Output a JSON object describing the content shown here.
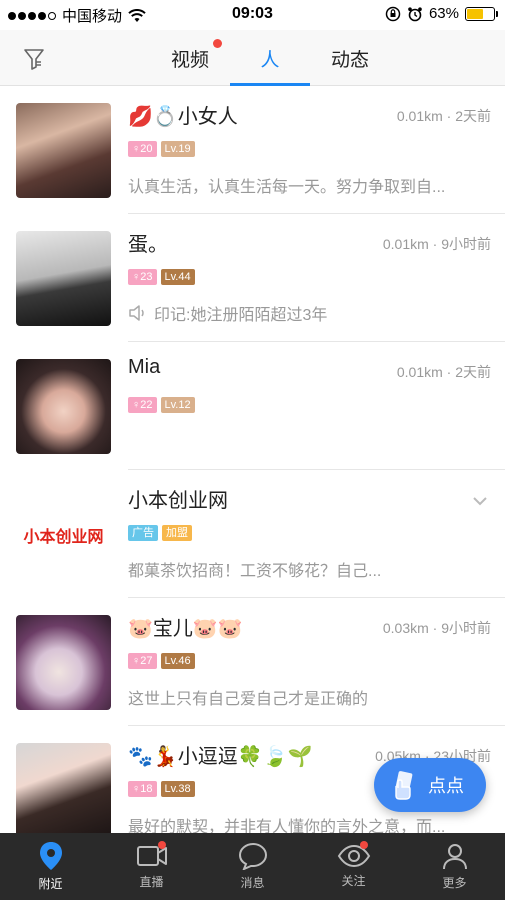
{
  "status_bar": {
    "carrier": "中国移动",
    "time": "09:03",
    "battery_percent": "63%",
    "battery_level": 0.63
  },
  "header": {
    "filter_icon": "filter-icon",
    "tabs": [
      {
        "label": "视频",
        "active": false,
        "has_dot": true
      },
      {
        "label": "人",
        "active": true,
        "has_dot": false
      },
      {
        "label": "动态",
        "active": false,
        "has_dot": false
      }
    ]
  },
  "people": [
    {
      "name": "💋💍小女人",
      "meta": "0.01km · 2天前",
      "age": "♀20",
      "level": "Lv.19",
      "bio": "认真生活，认真生活每一天。努力争取到自..."
    },
    {
      "name": "蛋。",
      "meta": "0.01km · 9小时前",
      "age": "♀23",
      "level": "Lv.44",
      "bio": "印记:她注册陌陌超过3年"
    },
    {
      "name": "Mia",
      "meta": "0.01km · 2天前",
      "age": "♀22",
      "level": "Lv.12",
      "bio": ""
    },
    {
      "name": "小本创业网",
      "logo_text": "小本创业网",
      "meta": "",
      "tag1": "广告",
      "tag2": "加盟",
      "bio": "都菓茶饮招商！工资不够花？自己..."
    },
    {
      "name": "🐷宝儿🐷🐷",
      "meta": "0.03km · 9小时前",
      "age": "♀27",
      "level": "Lv.46",
      "bio": "这世上只有自己爱自己才是正确的"
    },
    {
      "name": "🐾💃小逗逗🍀🍃🌱",
      "meta": "0.05km · 23小时前",
      "age": "♀18",
      "level": "Lv.38",
      "bio": "最好的默契，并非有人懂你的言外之意，而..."
    }
  ],
  "fab": {
    "label": "点点",
    "icon": "hand-card-icon"
  },
  "bottom_nav": [
    {
      "label": "附近",
      "icon": "location-pin-icon",
      "active": true,
      "has_dot": false
    },
    {
      "label": "直播",
      "icon": "video-camera-icon",
      "active": false,
      "has_dot": true
    },
    {
      "label": "消息",
      "icon": "chat-bubble-icon",
      "active": false,
      "has_dot": false
    },
    {
      "label": "关注",
      "icon": "eye-icon",
      "active": false,
      "has_dot": true
    },
    {
      "label": "更多",
      "icon": "person-icon",
      "active": false,
      "has_dot": false
    }
  ],
  "colors": {
    "accent": "#1a86f3",
    "red_dot": "#f2483f",
    "fab": "#3d86f1",
    "nav_bg": "#2a2a2a"
  }
}
